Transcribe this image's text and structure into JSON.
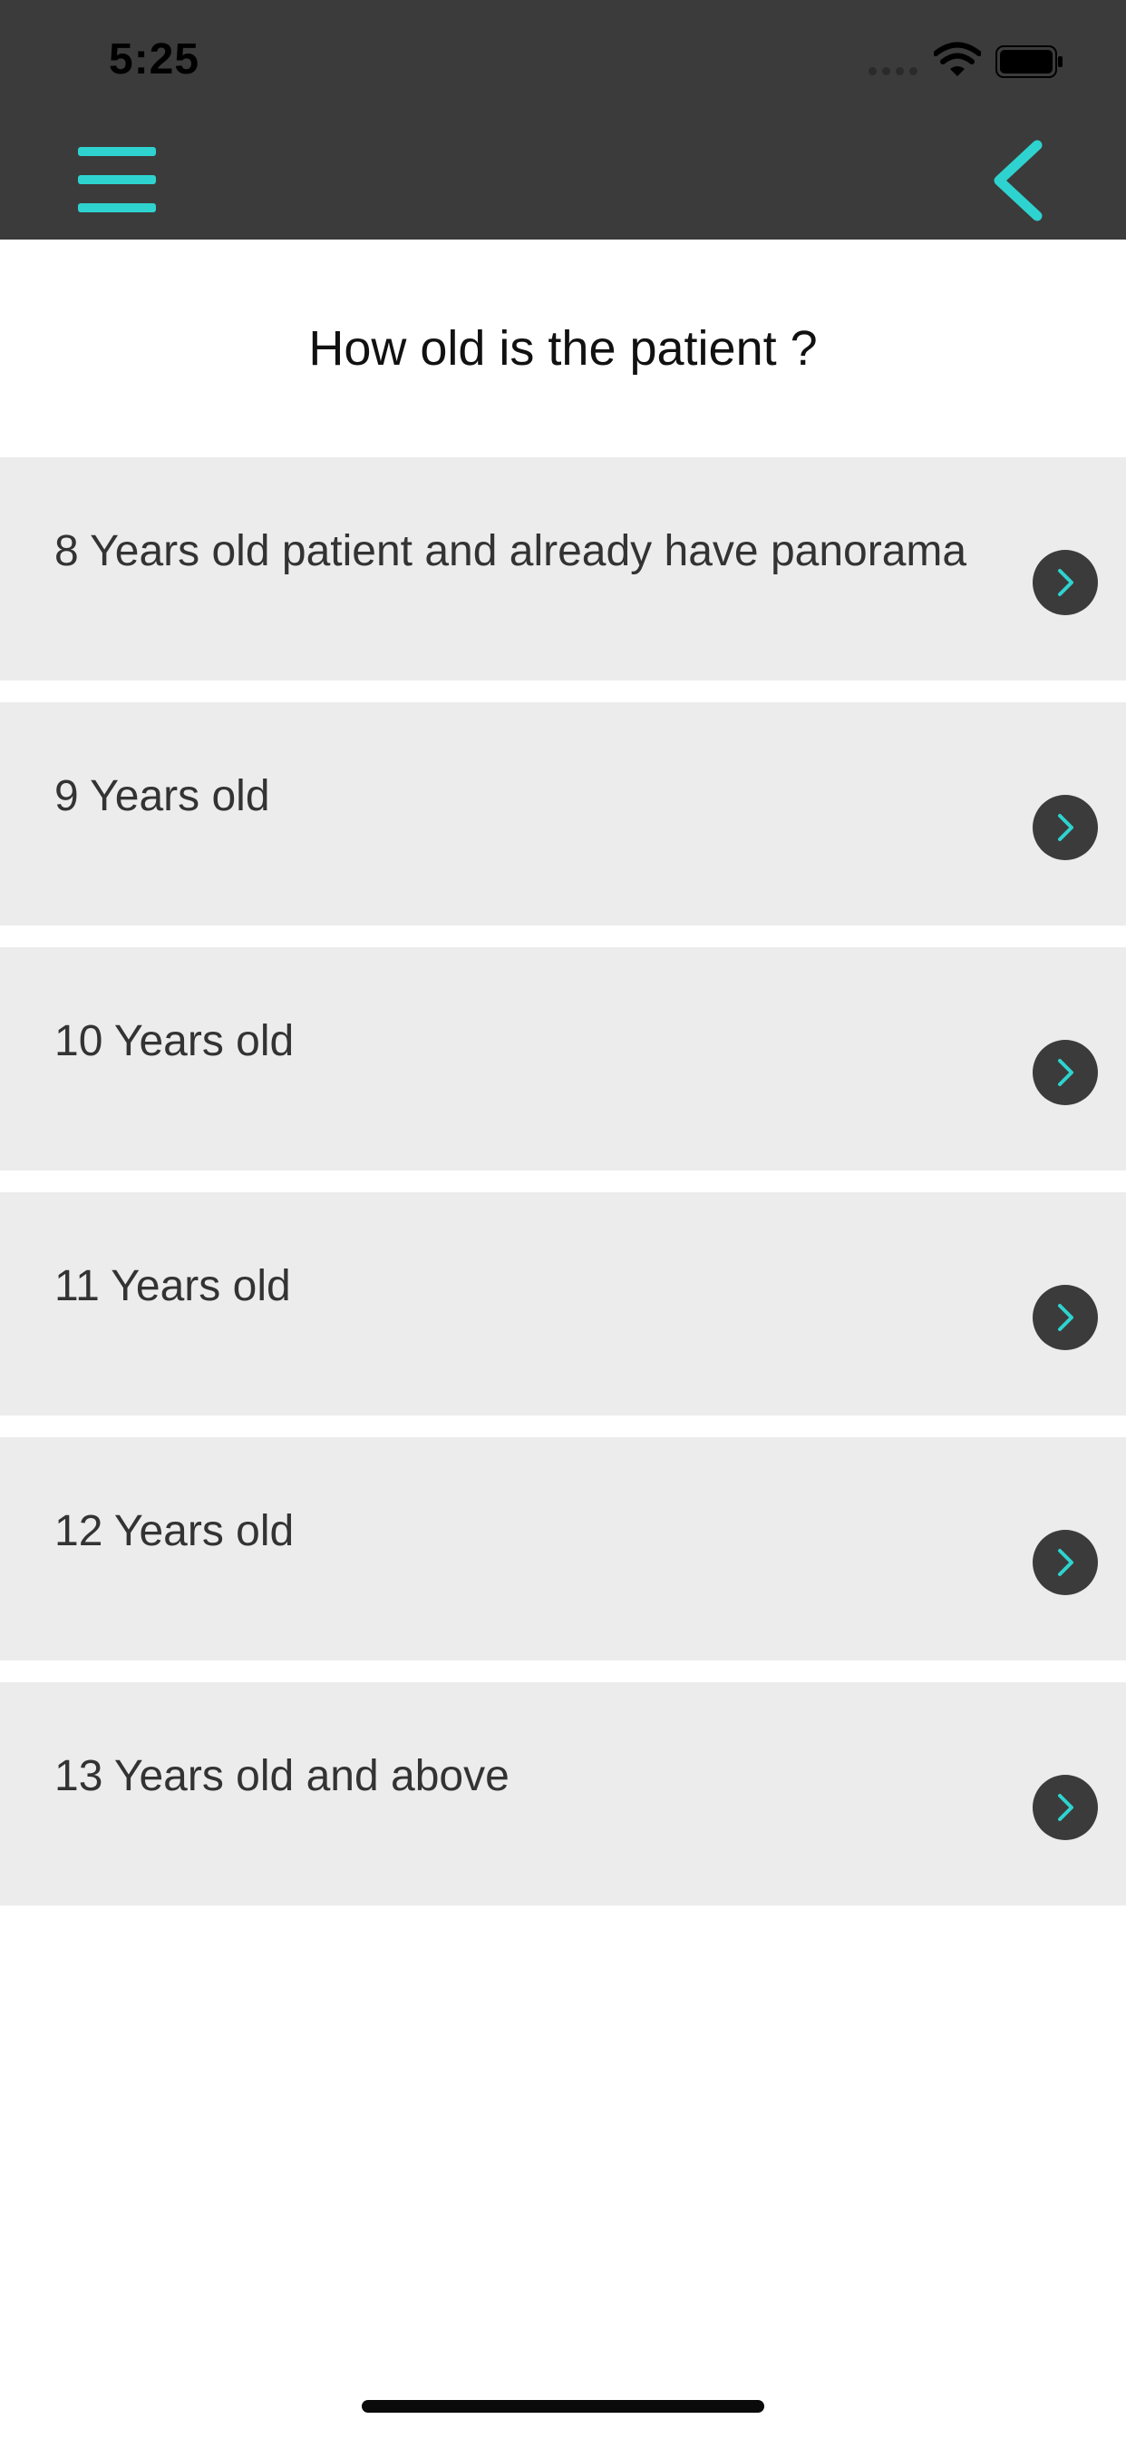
{
  "status_bar": {
    "time": "5:25"
  },
  "nav": {
    "menu_icon": "hamburger-menu-icon",
    "back_icon": "chevron-left-icon"
  },
  "question": "How old is the patient ?",
  "options": [
    {
      "label": "8 Years old patient and already have panorama",
      "icon": "chevron-right-icon"
    },
    {
      "label": "9 Years old",
      "icon": "chevron-right-icon"
    },
    {
      "label": "10 Years old",
      "icon": "chevron-right-icon"
    },
    {
      "label": "11 Years old",
      "icon": "chevron-right-icon"
    },
    {
      "label": "12 Years old",
      "icon": "chevron-right-icon"
    },
    {
      "label": "13 Years old and above",
      "icon": "chevron-right-icon"
    }
  ],
  "colors": {
    "header_bg": "#3b3b3b",
    "accent": "#2ed3cf",
    "option_bg": "#ececec",
    "text": "#333333"
  }
}
